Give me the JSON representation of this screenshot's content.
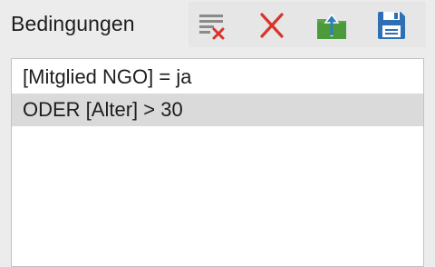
{
  "panel": {
    "title": "Bedingungen"
  },
  "toolbar": {
    "buttons": [
      {
        "icon": "clear-list-icon"
      },
      {
        "icon": "delete-icon"
      },
      {
        "icon": "export-folder-icon"
      },
      {
        "icon": "save-icon"
      }
    ]
  },
  "conditions": [
    {
      "text": "[Mitglied NGO] = ja",
      "selected": false
    },
    {
      "text": "ODER [Alter] > 30",
      "selected": true
    }
  ],
  "colors": {
    "delete_red": "#d9342b",
    "folder_green": "#5aa545",
    "save_blue": "#2f6fb3",
    "selection": "#dadada"
  }
}
